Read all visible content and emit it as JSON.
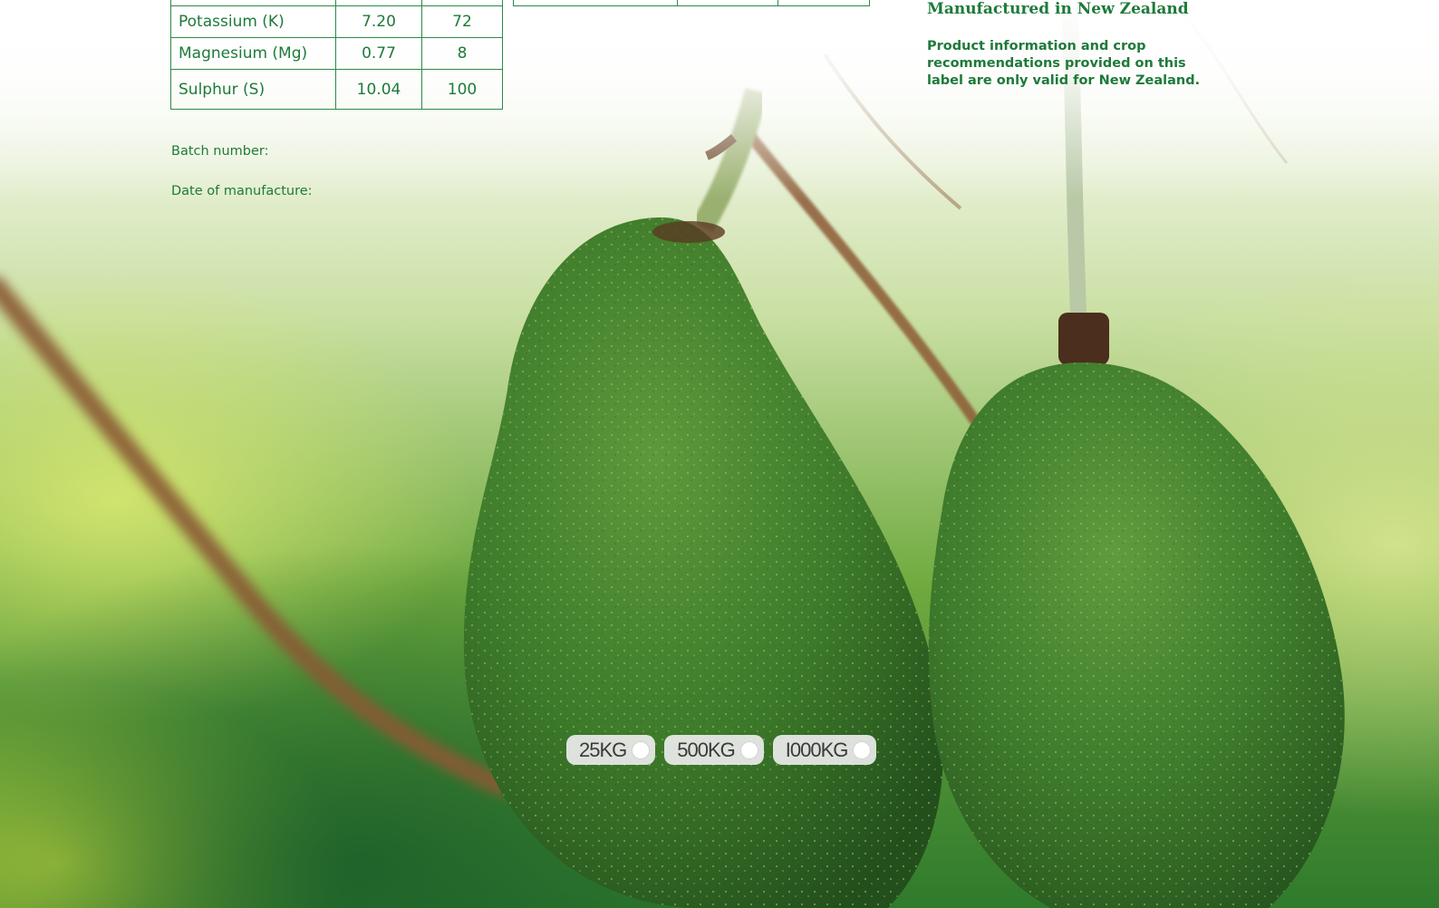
{
  "nutrients": [
    {
      "name": "Potassium (K)",
      "percent": "7.20",
      "kg_per_tonne": "72"
    },
    {
      "name": "Magnesium (Mg)",
      "percent": "0.77",
      "kg_per_tonne": "8"
    },
    {
      "name": "Sulphur (S)",
      "percent": "10.04",
      "kg_per_tonne": "100"
    }
  ],
  "batch_label": "Batch number:",
  "date_label": "Date of manufacture:",
  "manufactured": "Manufactured in New Zealand",
  "nz_note": "Product information and crop recommendations provided on this label are only valid for New Zealand.",
  "sizes": [
    "25KG",
    "500KG",
    "I000KG"
  ],
  "colors": {
    "brand_green": "#1e7a3a",
    "line_green": "#2c8a48"
  }
}
